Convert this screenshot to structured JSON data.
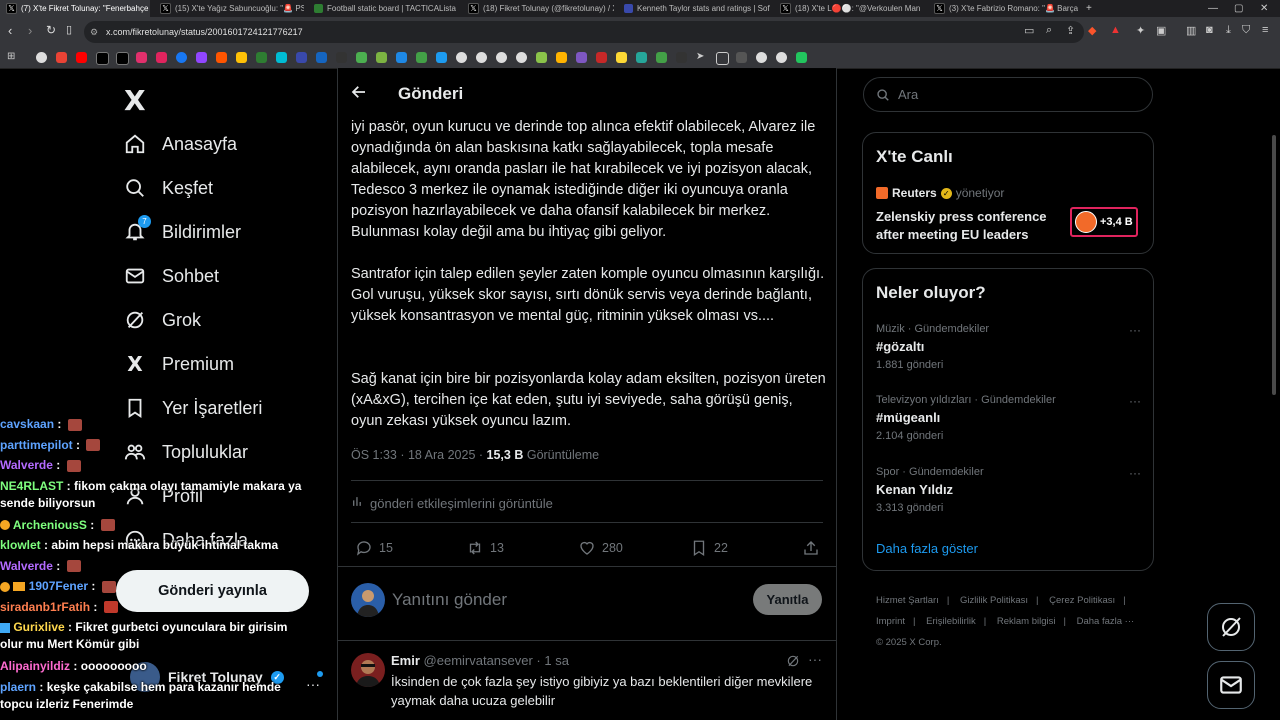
{
  "browser": {
    "tabs": [
      {
        "label": "(7) X'te Fikret Tolunay: \"Fenerbahçe",
        "active": true,
        "color": "#000000"
      },
      {
        "label": "(15) X'te Yağız Sabuncuoğlu: \"🚨 PSV",
        "active": false,
        "color": "#000000"
      },
      {
        "label": "Football static board | TACTICALista",
        "active": false,
        "color": "#2e7d32"
      },
      {
        "label": "(18) Fikret Tolunay (@fikretolunay) / X",
        "active": false,
        "color": "#000000"
      },
      {
        "label": "Kenneth Taylor stats and ratings | Sofa",
        "active": false,
        "color": "#3949ab"
      },
      {
        "label": "(18) X'te L🔴⚪: \"@Verkoulen Man",
        "active": false,
        "color": "#000000"
      },
      {
        "label": "(3) X'te Fabrizio Romano: \"🚨 Barça",
        "active": false,
        "color": "#000000"
      }
    ],
    "url": "x.com/fikretolunay/status/2001601724121776217"
  },
  "nav": {
    "logo": "X",
    "items": [
      {
        "label": "Anasayfa",
        "icon": "home-icon"
      },
      {
        "label": "Keşfet",
        "icon": "search-icon"
      },
      {
        "label": "Bildirimler",
        "icon": "bell-icon",
        "badge": "7"
      },
      {
        "label": "Sohbet",
        "icon": "mail-icon"
      },
      {
        "label": "Grok",
        "icon": "grok-icon"
      },
      {
        "label": "Premium",
        "icon": "x-icon"
      },
      {
        "label": "Yer İşaretleri",
        "icon": "bookmark-icon"
      },
      {
        "label": "Topluluklar",
        "icon": "people-icon"
      },
      {
        "label": "Profil",
        "icon": "person-icon"
      },
      {
        "label": "Daha fazla",
        "icon": "more-icon"
      }
    ],
    "post_button": "Gönderi yayınla",
    "profile_name": "Fikret Tolunay"
  },
  "main": {
    "title": "Gönderi",
    "paragraphs": [
      "iyi pasör, oyun kurucu ve derinde top alınca efektif olabilecek, Alvarez ile oynadığında ön alan baskısına katkı sağlayabilecek, topla mesafe alabilecek, aynı oranda pasları ile hat kırabilecek ve iyi pozisyon alacak, Tedesco 3 merkez ile oynamak istediğinde diğer iki oyuncuya oranla pozisyon hazırlayabilecek ve daha ofansif kalabilecek bir merkez. Bulunması kolay değil ama bu ihtiyaç gibi geliyor.",
      "Santrafor için talep edilen şeyler zaten komple oyuncu olmasının karşılığı. Gol vuruşu, yüksek skor sayısı, sırtı dönük servis veya derinde bağlantı, yüksek konsantrasyon ve mental güç, ritminin yüksek olması vs....",
      "Sağ kanat için bire bir pozisyonlarda kolay adam eksilten, pozisyon üreten (xA&xG), tercihen içe kat eden, şutu iyi seviyede, saha görüşü geniş, oyun zekası yüksek oyuncu lazım."
    ],
    "timestamp": "ÖS 1:33 · 18 Ara 2025 ·",
    "views_count": "15,3 B",
    "views_label": "Görüntüleme",
    "interactions_link": "gönderi etkileşimlerini görüntüle",
    "actions": {
      "replies": "15",
      "reposts": "13",
      "likes": "280",
      "bookmarks": "22"
    },
    "reply_placeholder": "Yanıtını gönder",
    "reply_button": "Yanıtla",
    "reply": {
      "name": "Emir",
      "handle": "@eemirvatansever · 1 sa",
      "text": "İksinden de çok fazla şey istiyo gibiyiz ya bazı beklentileri diğer mevkilere yaymak daha ucuza gelebilir"
    }
  },
  "sidebar": {
    "search_placeholder": "Ara",
    "live": {
      "title": "X'te Canlı",
      "source": "Reuters",
      "source_role": "yönetiyor",
      "text": "Zelenskiy press conference after meeting EU leaders",
      "count": "+3,4 B"
    },
    "trends": {
      "title": "Neler oluyor?",
      "items": [
        {
          "category": "Müzik · Gündemdekiler",
          "tag": "#gözaltı",
          "count": "1.881 gönderi"
        },
        {
          "category": "Televizyon yıldızları · Gündemdekiler",
          "tag": "#mügeanlı",
          "count": "2.104 gönderi"
        },
        {
          "category": "Spor · Gündemdekiler",
          "tag": "Kenan Yıldız",
          "count": "3.313 gönderi"
        }
      ],
      "show_more": "Daha fazla göster"
    },
    "footer": {
      "line1": [
        "Hizmet Şartları",
        "|",
        "Gizlilik Politikası",
        "|",
        "Çerez Politikası",
        "|"
      ],
      "line2": [
        "Imprint",
        "|",
        "Erişilebilirlik",
        "|",
        "Reklam bilgisi",
        "|",
        "Daha fazla ···"
      ],
      "copyright": "© 2025 X Corp."
    }
  },
  "chat": [
    {
      "user": "cavskaan",
      "color": "#5ea3ff",
      "msg": "",
      "emote": true
    },
    {
      "user": "parttimepilot",
      "color": "#5ea3ff",
      "msg": "",
      "emote": true
    },
    {
      "user": "Walverde",
      "color": "#b36bff",
      "msg": "",
      "emote": true
    },
    {
      "user": "NE4RLAST",
      "color": "#7fff7f",
      "msg": "fikom çakma olayı tamamiyle makara ya sende biliyorsun",
      "wrap": true
    },
    {
      "user": "ArcheniousS",
      "color": "#7fff7f",
      "msg": "",
      "emote": true
    },
    {
      "user": "klowlet",
      "color": "#7fff7f",
      "msg": "abim hepsi makara büyük ihtimal takma"
    },
    {
      "user": "Walverde",
      "color": "#b36bff",
      "msg": "",
      "emote": true
    },
    {
      "user": "1907Fener",
      "color": "#5ea3ff",
      "msg": "",
      "emote": true
    },
    {
      "user": "siradanb1rFatih",
      "color": "#ff7f50",
      "msg": "",
      "emote": true
    },
    {
      "user": "Gurixlive",
      "color": "#ffd84d",
      "msg": "Fikret gurbetci oyunculara bir girisim olur mu Mert Kömür gibi",
      "wrap": true
    },
    {
      "user": "Alipainyildiz",
      "color": "#ff6bd0",
      "msg": "ooooooooo"
    },
    {
      "user": "plaern",
      "color": "#5ea3ff",
      "msg": "keşke çakabilse hem para kazanır hemde topcu izleriz Fenerimde",
      "wrap": true
    }
  ],
  "colors": {
    "accent": "#1d9bf0",
    "live_border": "#e0245e",
    "reuters": "#f26a29"
  }
}
